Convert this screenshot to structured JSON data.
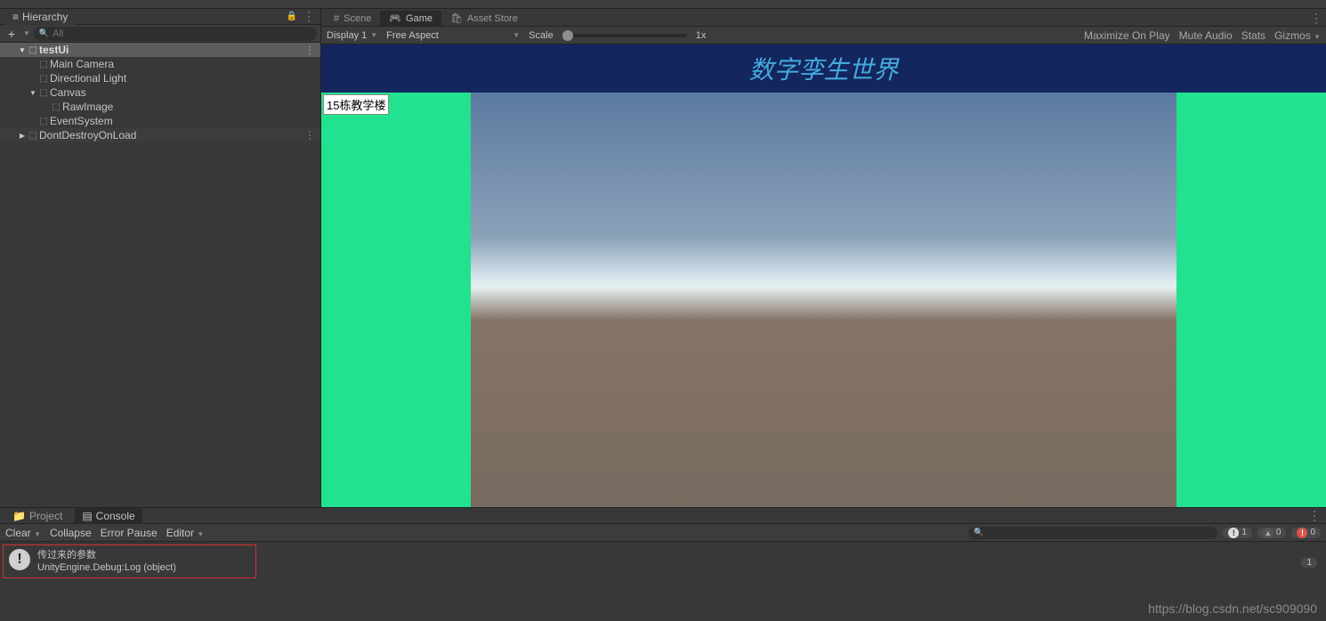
{
  "hierarchy": {
    "title": "Hierarchy",
    "searchPlaceholder": "All",
    "scene": "testUi",
    "items": [
      {
        "label": "Main Camera"
      },
      {
        "label": "Directional Light"
      },
      {
        "label": "Canvas"
      },
      {
        "label": "RawImage"
      },
      {
        "label": "EventSystem"
      },
      {
        "label": "DontDestroyOnLoad"
      }
    ]
  },
  "viewTabs": {
    "scene": "Scene",
    "game": "Game",
    "assetStore": "Asset Store"
  },
  "gameToolbar": {
    "display": "Display 1",
    "aspect": "Free Aspect",
    "scaleLabel": "Scale",
    "scaleValue": "1x",
    "maximize": "Maximize On Play",
    "muteAudio": "Mute Audio",
    "stats": "Stats",
    "gizmos": "Gizmos"
  },
  "gameView": {
    "bannerTitle": "数字孪生世界",
    "tagLabel": "15栋教学楼"
  },
  "bottomTabs": {
    "project": "Project",
    "console": "Console"
  },
  "consoleToolbar": {
    "clear": "Clear",
    "collapse": "Collapse",
    "errorPause": "Error Pause",
    "editor": "Editor",
    "counts": {
      "info": "1",
      "warn": "0",
      "err": "0"
    }
  },
  "consoleLog": {
    "line1": "传过来的参数",
    "line2": "UnityEngine.Debug:Log (object)",
    "count": "1"
  },
  "watermark": "https://blog.csdn.net/sc909090"
}
